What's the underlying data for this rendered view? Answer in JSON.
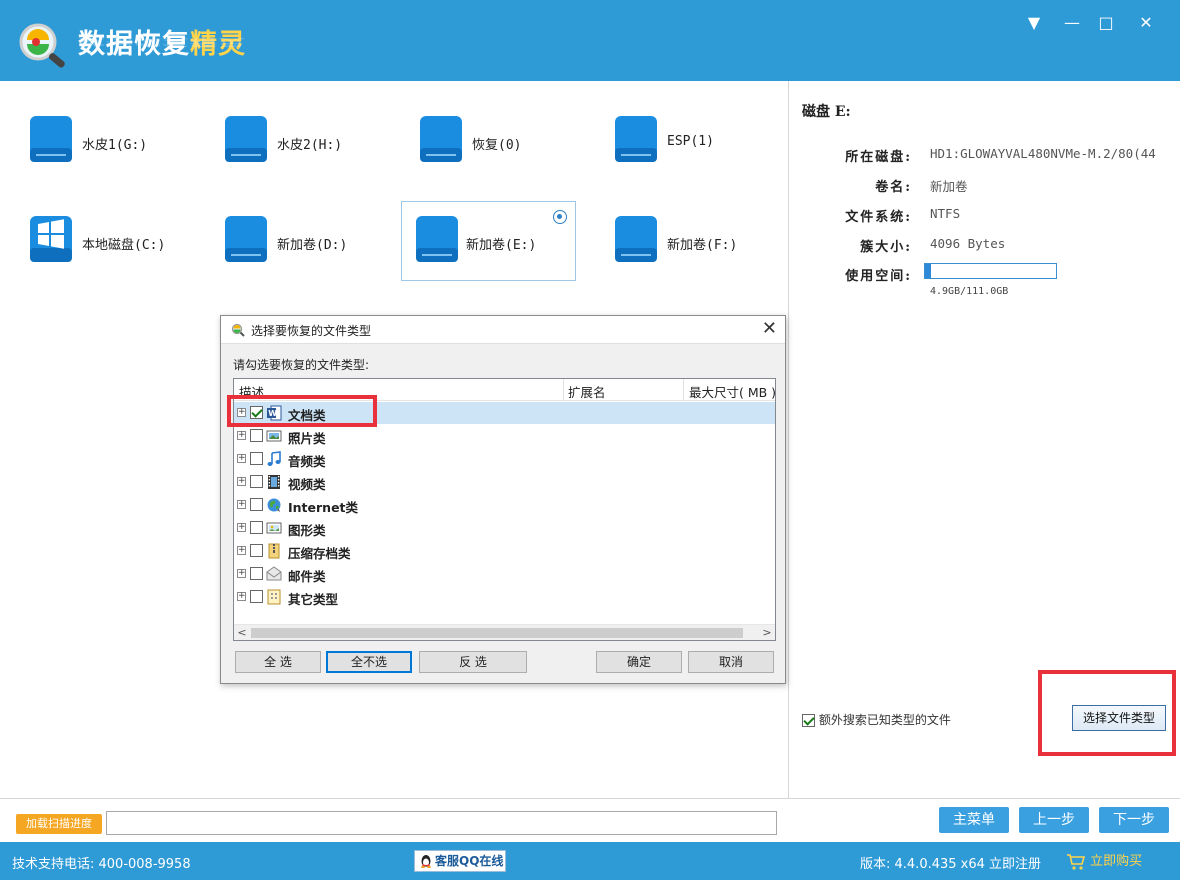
{
  "app": {
    "title_main": "数据恢复",
    "title_accent": "精灵"
  },
  "window_controls": {
    "menu": "▼",
    "minimize": "—",
    "maximize": "□",
    "close": "✕"
  },
  "drives": [
    {
      "label": "水皮1(G:)",
      "icon": "drive-icon"
    },
    {
      "label": "水皮2(H:)",
      "icon": "drive-icon"
    },
    {
      "label": "恢复(0)",
      "icon": "drive-icon"
    },
    {
      "label": "ESP(1)",
      "icon": "drive-icon"
    },
    {
      "label": "本地磁盘(C:)",
      "icon": "windows-drive-icon"
    },
    {
      "label": "新加卷(D:)",
      "icon": "drive-icon"
    },
    {
      "label": "新加卷(E:)",
      "icon": "drive-icon",
      "selected": true
    },
    {
      "label": "新加卷(F:)",
      "icon": "drive-icon"
    }
  ],
  "disk_info": {
    "title": "磁盘 E:",
    "rows": [
      {
        "key": "所在磁盘:",
        "value": "HD1:GLOWAYVAL480NVMe-M.2/80(44"
      },
      {
        "key": "卷名:",
        "value": "新加卷"
      },
      {
        "key": "文件系统:",
        "value": "NTFS"
      },
      {
        "key": "簇大小:",
        "value": "4096 Bytes"
      },
      {
        "key": "使用空间:",
        "value": ""
      }
    ],
    "usage_text": "4.9GB/111.0GB",
    "usage_fraction": 0.044
  },
  "extra_search": {
    "label": "额外搜索已知类型的文件",
    "checked": true
  },
  "select_filetype_button": "选择文件类型",
  "dialog": {
    "title": "选择要恢复的文件类型",
    "close": "✕",
    "prompt": "请勾选要恢复的文件类型:",
    "columns": [
      "描述",
      "扩展名",
      "最大尺寸( MB )"
    ],
    "rows": [
      {
        "label": "文档类",
        "icon": "word-document-icon",
        "checked": true,
        "selected": true
      },
      {
        "label": "照片类",
        "icon": "photo-icon",
        "checked": false
      },
      {
        "label": "音频类",
        "icon": "music-note-icon",
        "checked": false
      },
      {
        "label": "视频类",
        "icon": "film-icon",
        "checked": false
      },
      {
        "label": "Internet类",
        "icon": "globe-icon",
        "checked": false
      },
      {
        "label": "图形类",
        "icon": "image-icon",
        "checked": false
      },
      {
        "label": "压缩存档类",
        "icon": "zip-icon",
        "checked": false
      },
      {
        "label": "邮件类",
        "icon": "mail-icon",
        "checked": false
      },
      {
        "label": "其它类型",
        "icon": "other-file-icon",
        "checked": false
      }
    ],
    "expander": "+",
    "scroll_left": "<",
    "scroll_right": ">",
    "buttons": {
      "select_all": "全 选",
      "select_none": "全不选",
      "invert": "反 选",
      "ok": "确定",
      "cancel": "取消"
    }
  },
  "bottom": {
    "load_progress": "加载扫描进度",
    "main_menu": "主菜单",
    "prev": "上一步",
    "next": "下一步"
  },
  "status": {
    "phone": "技术支持电话: 400-008-9958",
    "qq": "客服QQ在线",
    "version": "版本: 4.4.0.435 x64  立即注册",
    "buy": "立即购买"
  },
  "colors": {
    "brand_blue": "#2e9ad6",
    "accent_yellow": "#ffd34a",
    "highlight_red": "#e8313a",
    "button_blue": "#3aa0e0",
    "orange": "#f5a623"
  }
}
